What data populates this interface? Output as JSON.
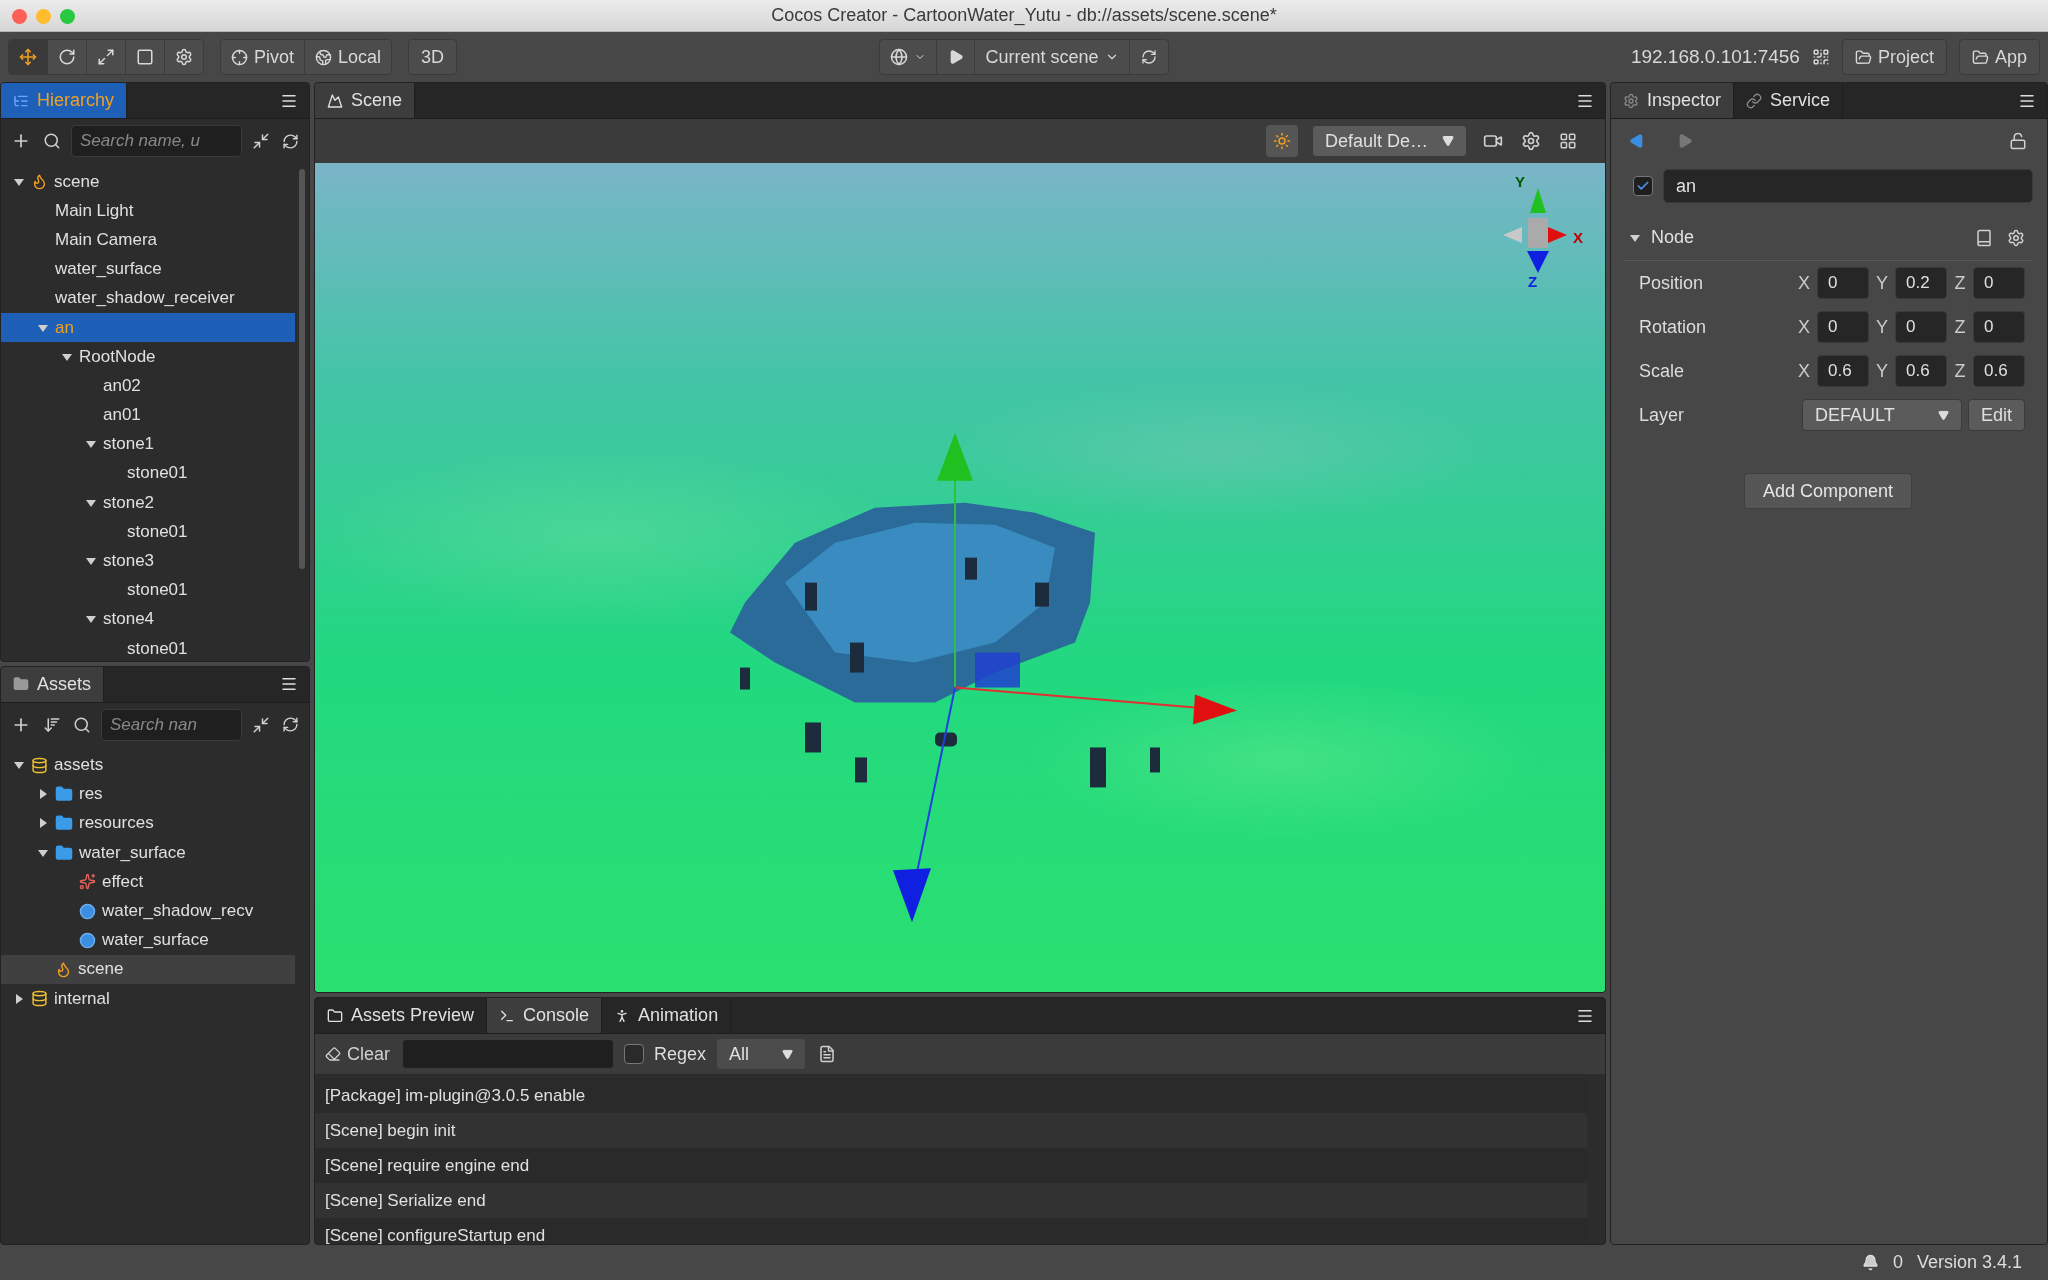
{
  "window": {
    "title": "Cocos Creator - CartoonWater_Yutu - db://assets/scene.scene*"
  },
  "toolbar": {
    "tools": [
      {
        "kind": "move",
        "selected": true
      },
      {
        "kind": "rotate",
        "selected": false
      },
      {
        "kind": "scale",
        "selected": false
      },
      {
        "kind": "rect",
        "selected": false
      },
      {
        "kind": "settings",
        "selected": false
      }
    ],
    "pivot": "Pivot",
    "space": "Local",
    "mode": "3D",
    "scene_select": "Current scene",
    "address": "192.168.0.101:7456",
    "buttons": [
      "Project",
      "App"
    ]
  },
  "hierarchy": {
    "tab": "Hierarchy",
    "search": {
      "placeholder": "Search name, u"
    },
    "tree": [
      {
        "label": "scene",
        "kind": "scene",
        "expanded": true,
        "selected": false,
        "children": [
          {
            "label": "Main Light",
            "selected": false
          },
          {
            "label": "Main Camera",
            "selected": false
          },
          {
            "label": "water_surface",
            "selected": false
          },
          {
            "label": "water_shadow_receiver",
            "selected": false
          },
          {
            "label": "an",
            "expanded": true,
            "selected": true,
            "children": [
              {
                "label": "RootNode",
                "expanded": true,
                "selected": false,
                "children": [
                  {
                    "label": "an02",
                    "selected": false
                  },
                  {
                    "label": "an01",
                    "selected": false
                  },
                  {
                    "label": "stone1",
                    "expanded": true,
                    "selected": false,
                    "children": [
                      {
                        "label": "stone01",
                        "selected": false
                      }
                    ]
                  },
                  {
                    "label": "stone2",
                    "expanded": true,
                    "selected": false,
                    "children": [
                      {
                        "label": "stone01",
                        "selected": false
                      }
                    ]
                  },
                  {
                    "label": "stone3",
                    "expanded": true,
                    "selected": false,
                    "children": [
                      {
                        "label": "stone01",
                        "selected": false
                      }
                    ]
                  },
                  {
                    "label": "stone4",
                    "expanded": true,
                    "selected": false,
                    "children": [
                      {
                        "label": "stone01",
                        "selected": false
                      }
                    ]
                  }
                ]
              }
            ]
          }
        ]
      }
    ]
  },
  "assets": {
    "tab": "Assets",
    "search": {
      "placeholder": "Search nan"
    },
    "tree": [
      {
        "label": "assets",
        "kind": "database",
        "expanded": true,
        "selected": false,
        "children": [
          {
            "label": "res",
            "kind": "folder",
            "expanded": false,
            "selected": false
          },
          {
            "label": "resources",
            "kind": "folder",
            "expanded": false,
            "selected": false
          },
          {
            "label": "water_surface",
            "kind": "folder",
            "expanded": true,
            "selected": false,
            "children": [
              {
                "label": "effect",
                "kind": "effect",
                "selected": false
              },
              {
                "label": "water_shadow_recv",
                "kind": "material",
                "selected": false
              },
              {
                "label": "water_surface",
                "kind": "material",
                "selected": false
              }
            ]
          },
          {
            "label": "scene",
            "kind": "scene",
            "selected": true
          }
        ]
      },
      {
        "label": "internal",
        "kind": "database",
        "expanded": false,
        "selected": false
      }
    ]
  },
  "scene": {
    "tab": "Scene",
    "camera_select": "Default De…",
    "gizmo_axes": [
      "Y",
      "X",
      "Z"
    ]
  },
  "console": {
    "tabs": [
      {
        "label": "Assets Preview",
        "kind": "folder",
        "selected": false
      },
      {
        "label": "Console",
        "kind": "terminal",
        "selected": true
      },
      {
        "label": "Animation",
        "kind": "animation",
        "selected": false
      }
    ],
    "clear": "Clear",
    "regex": {
      "label": "Regex",
      "checked": false
    },
    "filter": "All",
    "lines": [
      "[Package] im-plugin@3.0.5 enable",
      "[Scene] begin init",
      "[Scene] require engine end",
      "[Scene] Serialize end",
      "[Scene] configureStartup end"
    ]
  },
  "inspector": {
    "tabs": [
      {
        "label": "Inspector",
        "kind": "gear",
        "selected": true
      },
      {
        "label": "Service",
        "kind": "link",
        "selected": false
      }
    ],
    "node": {
      "active": true,
      "name": "an"
    },
    "section": {
      "title": "Node",
      "expanded": true
    },
    "properties": [
      {
        "label": "Position",
        "kind": "vector",
        "values": [
          {
            "axis": "X",
            "value": "0"
          },
          {
            "axis": "Y",
            "value": "0.2"
          },
          {
            "axis": "Z",
            "value": "0"
          }
        ]
      },
      {
        "label": "Rotation",
        "kind": "vector",
        "values": [
          {
            "axis": "X",
            "value": "0"
          },
          {
            "axis": "Y",
            "value": "0"
          },
          {
            "axis": "Z",
            "value": "0"
          }
        ]
      },
      {
        "label": "Scale",
        "kind": "vector",
        "values": [
          {
            "axis": "X",
            "value": "0.6"
          },
          {
            "axis": "Y",
            "value": "0.6"
          },
          {
            "axis": "Z",
            "value": "0.6"
          }
        ]
      },
      {
        "label": "Layer",
        "kind": "select",
        "value": "DEFAULT",
        "button": "Edit"
      }
    ],
    "add_component": "Add Component"
  },
  "status_bar": {
    "notifications": "0",
    "version": "Version 3.4.1"
  }
}
